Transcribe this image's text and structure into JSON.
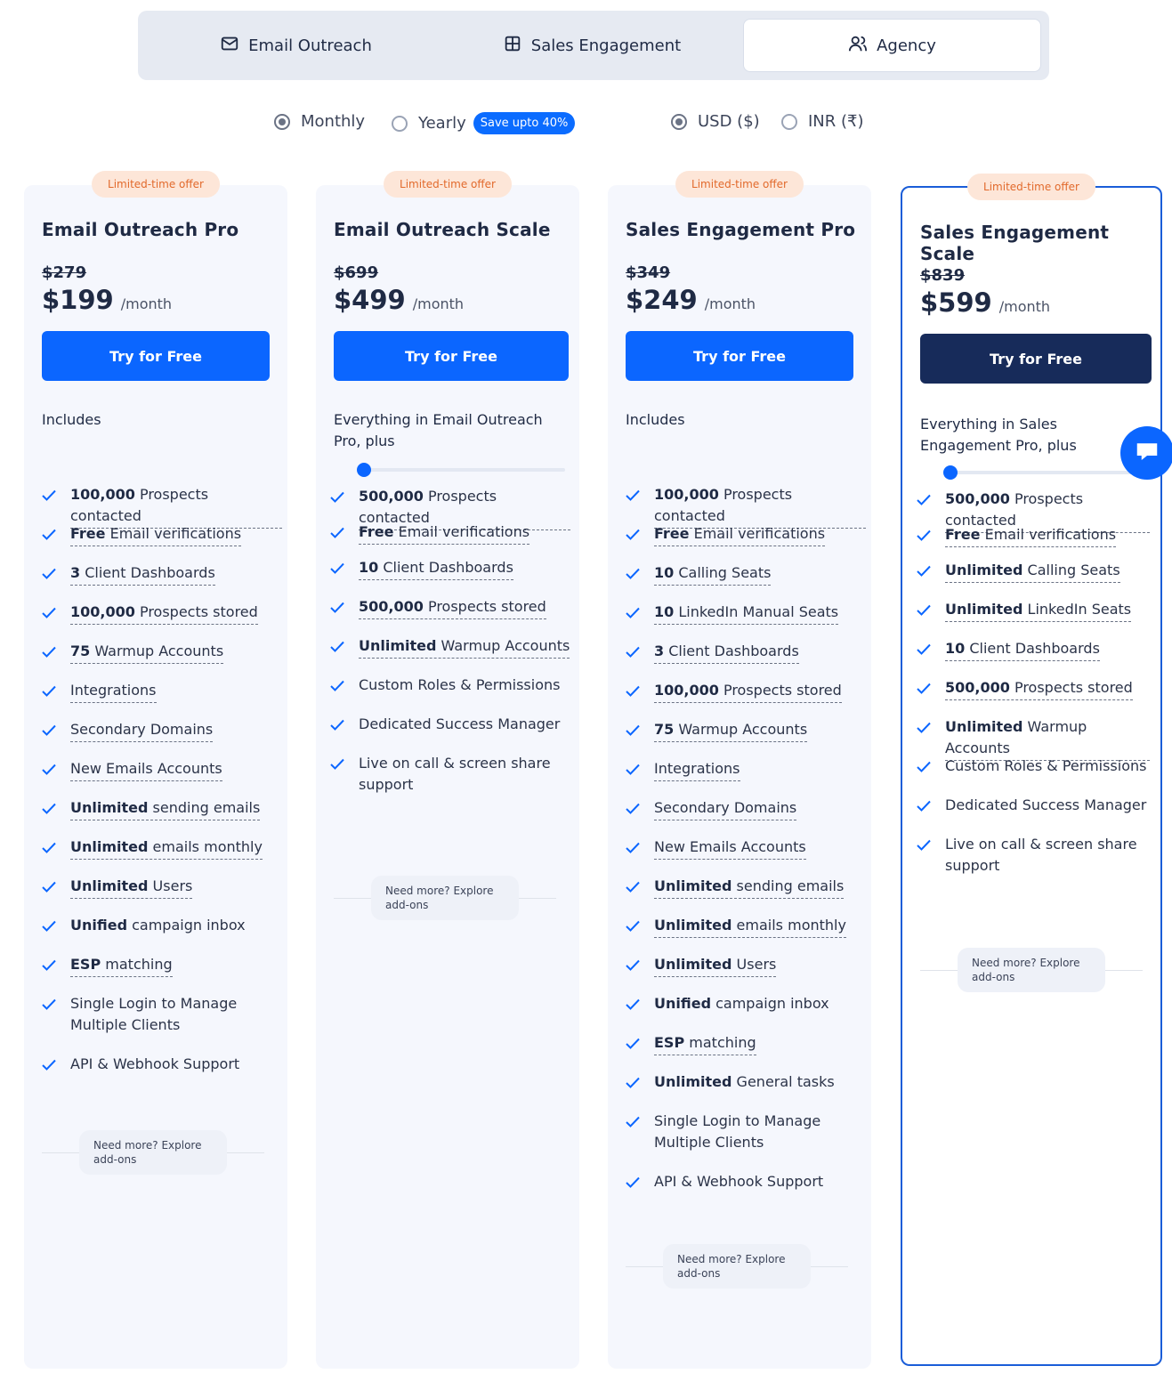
{
  "tabs": [
    {
      "label": "Email Outreach",
      "icon": "mail-icon"
    },
    {
      "label": "Sales Engagement",
      "icon": "grid-icon"
    },
    {
      "label": "Agency",
      "icon": "users-icon",
      "selected": true
    }
  ],
  "billing": {
    "monthly": "Monthly",
    "yearly": "Yearly",
    "save_badge": "Save upto 40%",
    "selected": "Monthly"
  },
  "currency": {
    "usd": "USD ($)",
    "inr": "INR (₹)",
    "selected": "USD ($)"
  },
  "common": {
    "offer": "Limited-time offer",
    "per": "/month",
    "cta": "Try for Free",
    "addons_line1": "Need more? Explore",
    "addons_line2": "add-ons"
  },
  "plans": [
    {
      "name": "Email Outreach Pro",
      "old_price": "$279",
      "price": "$199",
      "includes": "Includes",
      "features": [
        "100,000 Prospects contacted",
        "Free Email verifications",
        "3 Client Dashboards",
        "100,000 Prospects stored",
        "75 Warmup Accounts",
        "Integrations",
        "Secondary Domains",
        "New Emails Accounts",
        "Unlimited sending emails",
        "Unlimited emails monthly",
        "Unlimited Users",
        "Unified campaign inbox",
        "ESP matching",
        "Single Login to Manage Multiple Clients",
        "API & Webhook Support"
      ]
    },
    {
      "name": "Email Outreach Scale",
      "old_price": "$699",
      "price": "$499",
      "includes": "Everything in Email Outreach Pro, plus",
      "slider_value": 0,
      "features": [
        "500,000 Prospects contacted",
        "Free Email verifications",
        "10 Client Dashboards",
        "500,000 Prospects stored",
        "Unlimited Warmup Accounts",
        "Custom Roles & Permissions",
        "Dedicated Success Manager",
        "Live on call & screen share support"
      ]
    },
    {
      "name": "Sales Engagement Pro",
      "old_price": "$349",
      "price": "$249",
      "includes": "Includes",
      "features": [
        "100,000 Prospects contacted",
        "Free Email verifications",
        "10 Calling Seats",
        "10 LinkedIn Manual Seats",
        "3 Client Dashboards",
        "100,000 Prospects stored",
        "75 Warmup Accounts",
        "Integrations",
        "Secondary Domains",
        "New Emails Accounts",
        "Unlimited sending emails",
        "Unlimited emails monthly",
        "Unlimited Users",
        "Unified campaign inbox",
        "ESP matching",
        "Unlimited General tasks",
        "Single Login to Manage Multiple Clients",
        "API & Webhook Support"
      ]
    },
    {
      "name": "Sales Engagement Scale",
      "old_price": "$839",
      "price": "$599",
      "includes": "Everything in Sales Engagement Pro, plus",
      "slider_value": 0,
      "features": [
        "500,000 Prospects contacted",
        "Free Email verifications",
        "Unlimited Calling Seats",
        "Unlimited LinkedIn Seats",
        "10 Client Dashboards",
        "500,000 Prospects stored",
        "Unlimited Warmup Accounts",
        "Custom Roles & Permissions",
        "Dedicated Success Manager",
        "Live on call & screen share support"
      ]
    }
  ],
  "colors": {
    "primary": "#0b66ff",
    "dark_cta": "#172b5a",
    "offer_bg": "#fde6d8",
    "offer_text": "#e26a2c",
    "card_bg": "#f5f7fd",
    "selected_border": "#1a5dd8"
  }
}
